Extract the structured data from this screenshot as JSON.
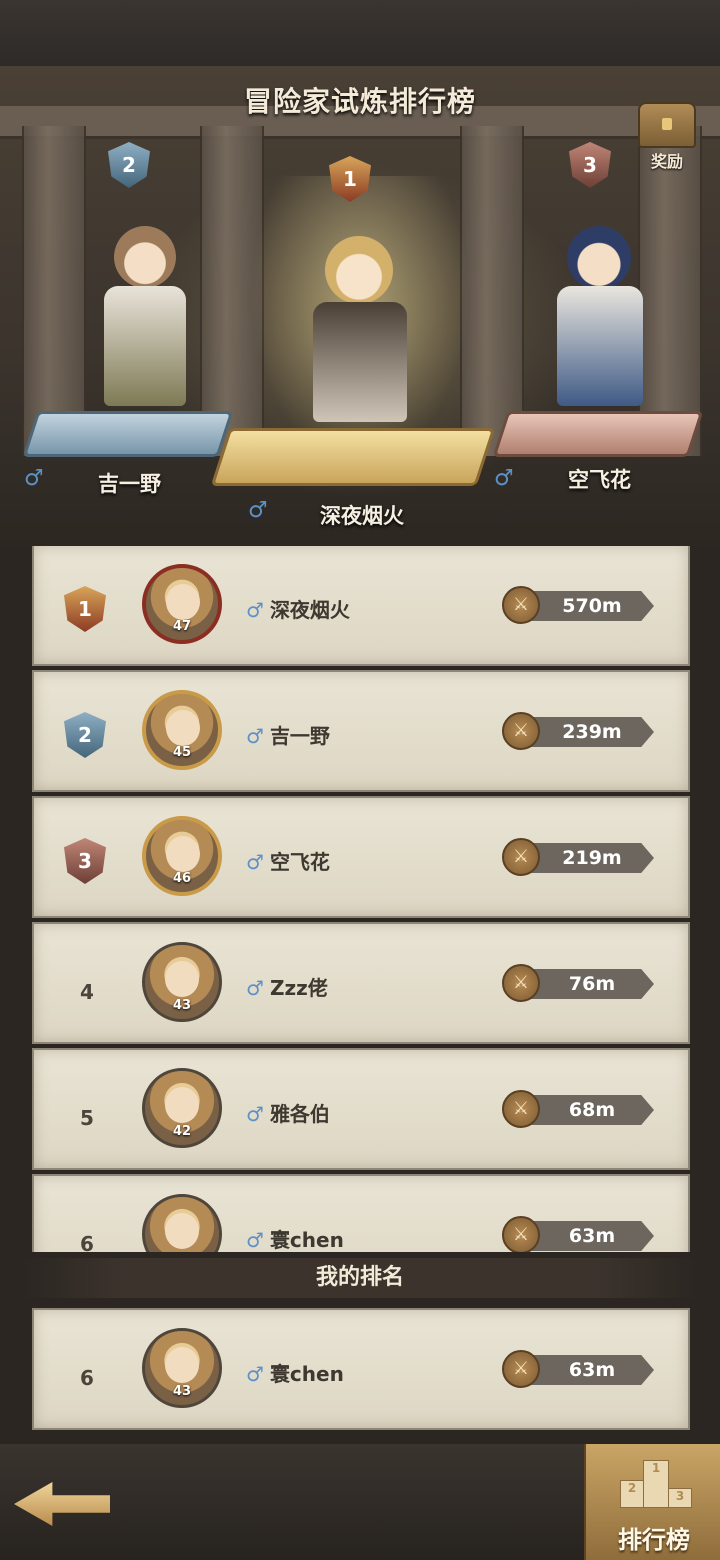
{
  "header": {
    "title": "冒险家试炼排行榜",
    "reward_label": "奖励",
    "reward_icon": "treasure-chest-icon"
  },
  "champions": [
    {
      "rank": "2",
      "name": "吉一野",
      "gender_icon": "♂"
    },
    {
      "rank": "1",
      "name": "深夜烟火",
      "gender_icon": "♂"
    },
    {
      "rank": "3",
      "name": "空飞花",
      "gender_icon": "♂"
    }
  ],
  "leaderboard": [
    {
      "rank": "1",
      "level": "47",
      "gender_icon": "♂",
      "name": "深夜烟火",
      "score": "570m"
    },
    {
      "rank": "2",
      "level": "45",
      "gender_icon": "♂",
      "name": "吉一野",
      "score": "239m"
    },
    {
      "rank": "3",
      "level": "46",
      "gender_icon": "♂",
      "name": "空飞花",
      "score": "219m"
    },
    {
      "rank": "4",
      "level": "43",
      "gender_icon": "♂",
      "name": "Zzz佬",
      "score": "76m"
    },
    {
      "rank": "5",
      "level": "42",
      "gender_icon": "♂",
      "name": "雅各伯",
      "score": "68m"
    },
    {
      "rank": "6",
      "level": "",
      "gender_icon": "♂",
      "name": "寰chen",
      "score": "63m"
    }
  ],
  "my_rank": {
    "header": "我的排名",
    "rank": "6",
    "level": "43",
    "gender_icon": "♂",
    "name": "寰chen",
    "score": "63m"
  },
  "score_icon": "crossed-swords-icon",
  "bottom": {
    "back_icon": "back-arrow-icon",
    "tab_label": "排行榜",
    "tab_icon": "podium-icon"
  },
  "colors": {
    "male": "#5e90c8",
    "gold_badge": "#b8734a",
    "silver_badge": "#5f8399",
    "bronze_badge": "#97625a"
  }
}
